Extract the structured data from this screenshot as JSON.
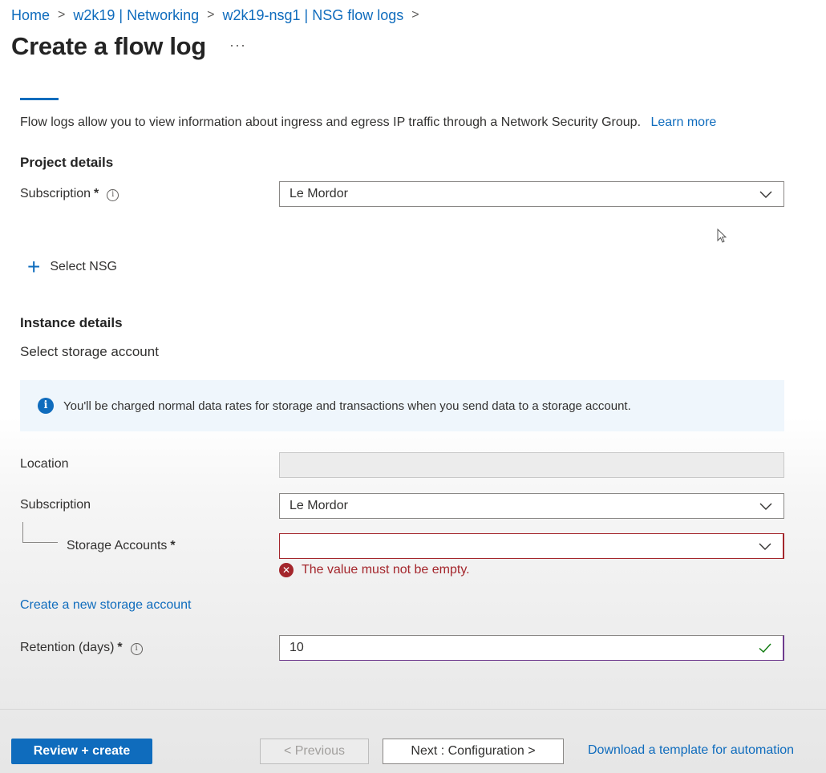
{
  "breadcrumb": {
    "items": [
      "Home",
      "w2k19 | Networking",
      "w2k19-nsg1 | NSG flow logs"
    ],
    "separator": ">"
  },
  "page": {
    "title": "Create a flow log",
    "more_label": "···"
  },
  "intro": {
    "text": "Flow logs allow you to view information about ingress and egress IP traffic through a Network Security Group.",
    "learn_more": "Learn more"
  },
  "project_details": {
    "heading": "Project details",
    "subscription_label": "Subscription",
    "subscription_value": "Le Mordor",
    "required_mark": "*",
    "info_glyph": "i"
  },
  "select_nsg": {
    "icon": "+",
    "label": "Select NSG"
  },
  "instance_details": {
    "heading": "Instance details",
    "subheading": "Select storage account",
    "info_banner": "You'll be charged normal data rates for storage and transactions when you send data to a storage account.",
    "info_glyph": "i",
    "location_label": "Location",
    "location_value": "",
    "subscription_label": "Subscription",
    "subscription_value": "Le Mordor",
    "storage_label": "Storage Accounts",
    "storage_value": "",
    "required_mark": "*",
    "error_glyph": "✕",
    "error_text": "The value must not be empty.",
    "create_link": "Create a new storage account",
    "retention_label": "Retention (days)",
    "retention_value": "10",
    "retention_info_glyph": "i"
  },
  "footer": {
    "review_create": "Review + create",
    "previous": "< Previous",
    "next": "Next : Configuration >",
    "download_template": "Download a template for automation"
  },
  "colors": {
    "accent": "#0f6cbd",
    "error": "#a4262c",
    "valid": "#107c10",
    "info_bg": "#eff6fc"
  },
  "icons": {
    "chevron": "chevron-down-icon",
    "info": "info-icon",
    "error": "error-circle-icon",
    "check": "checkmark-icon",
    "add": "plus-icon",
    "cursor": "mouse-pointer-icon"
  }
}
